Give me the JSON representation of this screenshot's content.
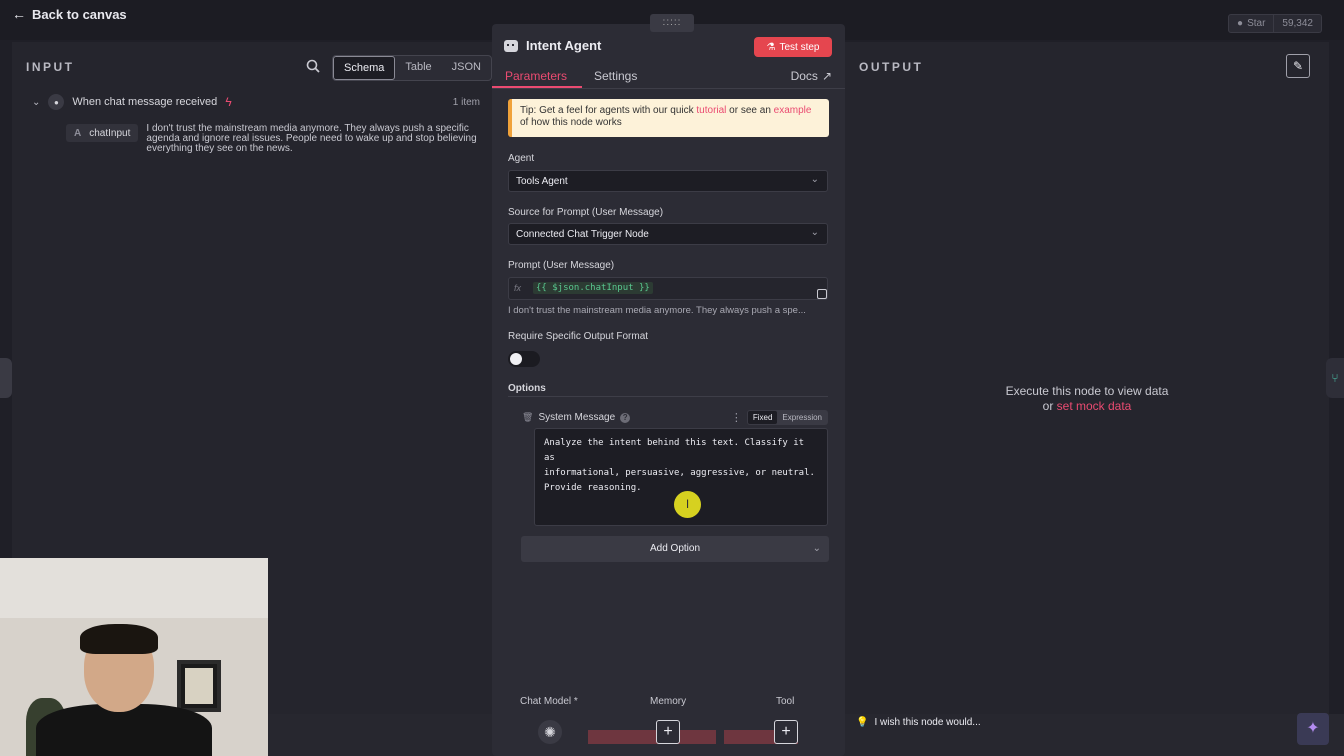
{
  "topbar": {
    "back_label": "Back to canvas",
    "star_label": "Star",
    "star_count": "59,342"
  },
  "input": {
    "title": "INPUT",
    "tabs": [
      "Schema",
      "Table",
      "JSON"
    ],
    "active_tab": "Schema",
    "trigger_name": "When chat message received",
    "item_count": "1 item",
    "field_type": "A",
    "field_name": "chatInput",
    "field_value": "I don't trust the mainstream media anymore. They always push a specific agenda and ignore real issues. People need to wake up and stop believing everything they see on the news."
  },
  "node": {
    "drag_handle": ":::::",
    "title": "Intent Agent",
    "test_label": "Test step",
    "tabs": {
      "parameters": "Parameters",
      "settings": "Settings",
      "docs": "Docs"
    },
    "tip": {
      "prefix": "Tip: Get a feel for agents with our quick ",
      "link1": "tutorial",
      "middle": " or see an ",
      "link2": "example",
      "suffix": " of how this node works"
    },
    "agent_label": "Agent",
    "agent_value": "Tools Agent",
    "source_label": "Source for Prompt (User Message)",
    "source_value": "Connected Chat Trigger Node",
    "prompt_label": "Prompt (User Message)",
    "prompt_fx": "fx",
    "prompt_expression": "{{ $json.chatInput }}",
    "prompt_preview": "I don't trust the mainstream media anymore. They always push a spe...",
    "require_label": "Require Specific Output Format",
    "require_on": false,
    "options_label": "Options",
    "system_label": "System Message",
    "fixed_label": "Fixed",
    "expression_label": "Expression",
    "system_text": "Analyze the intent behind this text. Classify it as\ninformational, persuasive, aggressive, or neutral.\nProvide reasoning.",
    "add_option_label": "Add Option",
    "sub_nodes": {
      "chat_model": "Chat Model *",
      "memory": "Memory",
      "tool": "Tool"
    }
  },
  "output": {
    "title": "OUTPUT",
    "exec_line1": "Execute this node to view data",
    "exec_or": "or ",
    "exec_link": "set mock data"
  },
  "footer": {
    "feedback": "I wish this node would..."
  },
  "colors": {
    "accent": "#ea4b71",
    "test_button": "#e5464f",
    "expression_green": "#59c78f",
    "tip_bg": "#fdf2d9"
  },
  "icons": [
    "arrow-left-icon",
    "github-icon",
    "search-icon",
    "chat-icon",
    "bolt-icon",
    "robot-icon",
    "flask-icon",
    "external-link-icon",
    "chevron-down-icon",
    "expand-icon",
    "trash-icon",
    "help-icon",
    "kebab-icon",
    "openai-icon",
    "plus-icon",
    "pencil-icon",
    "lightbulb-icon",
    "sparkle-icon"
  ]
}
